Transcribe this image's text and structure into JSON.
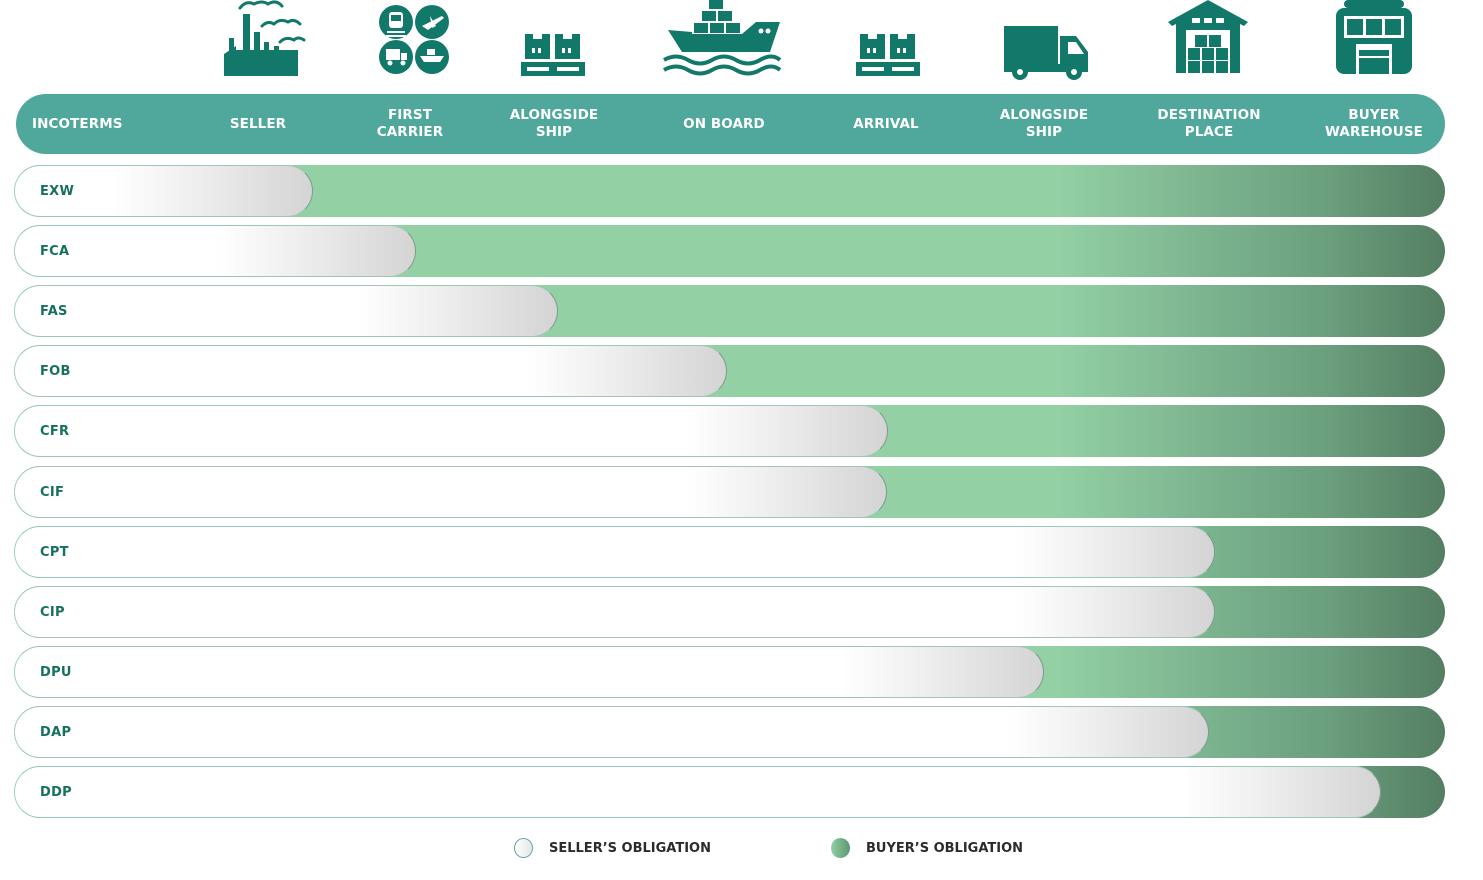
{
  "header": {
    "columns": [
      {
        "id": "incoterms",
        "lines": [
          "INCOTERMS"
        ]
      },
      {
        "id": "seller",
        "lines": [
          "SELLER"
        ]
      },
      {
        "id": "first-carrier",
        "lines": [
          "FIRST",
          "CARRIER"
        ]
      },
      {
        "id": "alongside-ship-origin",
        "lines": [
          "ALONGSIDE",
          "SHIP"
        ]
      },
      {
        "id": "on-board",
        "lines": [
          "ON BOARD"
        ]
      },
      {
        "id": "arrival",
        "lines": [
          "ARRIVAL"
        ]
      },
      {
        "id": "alongside-ship-destination",
        "lines": [
          "ALONGSIDE",
          "SHIP"
        ]
      },
      {
        "id": "destination-place",
        "lines": [
          "DESTINATION",
          "PLACE"
        ]
      },
      {
        "id": "buyer-warehouse",
        "lines": [
          "BUYER",
          "WAREHOUSE"
        ]
      }
    ]
  },
  "icons": [
    {
      "column": "seller",
      "name": "factory-icon"
    },
    {
      "column": "first-carrier",
      "name": "transport-modes-icon"
    },
    {
      "column": "alongside-ship-origin",
      "name": "pallet-boxes-icon"
    },
    {
      "column": "on-board",
      "name": "cargo-ship-icon"
    },
    {
      "column": "arrival",
      "name": "pallet-boxes-icon"
    },
    {
      "column": "alongside-ship-destination",
      "name": "delivery-truck-icon"
    },
    {
      "column": "destination-place",
      "name": "warehouse-icon"
    },
    {
      "column": "buyer-warehouse",
      "name": "store-building-icon"
    }
  ],
  "rows": [
    {
      "code": "EXW",
      "seller_obligation_share": 0.209
    },
    {
      "code": "FCA",
      "seller_obligation_share": 0.281
    },
    {
      "code": "FAS",
      "seller_obligation_share": 0.38
    },
    {
      "code": "FOB",
      "seller_obligation_share": 0.498
    },
    {
      "code": "CFR",
      "seller_obligation_share": 0.611
    },
    {
      "code": "CIF",
      "seller_obligation_share": 0.61
    },
    {
      "code": "CPT",
      "seller_obligation_share": 0.839
    },
    {
      "code": "CIP",
      "seller_obligation_share": 0.839
    },
    {
      "code": "DPU",
      "seller_obligation_share": 0.72
    },
    {
      "code": "DAP",
      "seller_obligation_share": 0.835
    },
    {
      "code": "DDP",
      "seller_obligation_share": 0.955
    }
  ],
  "legend": {
    "seller": "SELLER’S OBLIGATION",
    "buyer": "BUYER’S OBLIGATION"
  },
  "colors": {
    "header_bg": "#4fa89b",
    "icon": "#12786a",
    "code_text": "#16705f",
    "buyer_light": "#93d0a4",
    "buyer_dark": "#547e62",
    "seller_end": "#d4d4d4"
  }
}
